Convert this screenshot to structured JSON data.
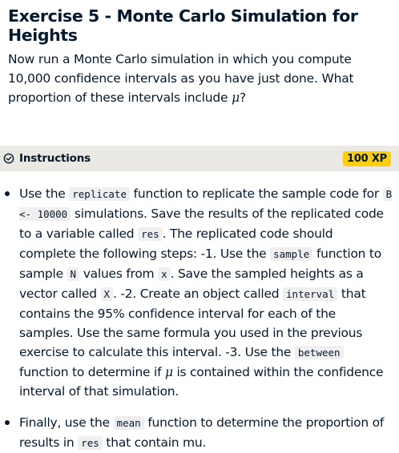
{
  "exercise": {
    "title": "Exercise 5 - Monte Carlo Simulation for Heights",
    "intro_text": "Now run a Monte Carlo simulation in which you compute 10,000 confidence intervals as you have just done. What proportion of these intervals include ",
    "intro_symbol": "μ",
    "intro_end": "?"
  },
  "instructions": {
    "label": "Instructions",
    "xp": "100 XP",
    "icon": "check-circle-icon"
  },
  "steps": [
    {
      "s1": "Use the ",
      "c1": "replicate",
      "s2": " function to replicate the sample code for ",
      "c2": "B <- 10000",
      "s3": " simulations. Save the results of the replicated code to a variable called ",
      "c3": "res",
      "s4": ". The replicated code should complete the following steps: -1. Use the ",
      "c4": "sample",
      "s5": " function to sample ",
      "c5": "N",
      "s6": " values from ",
      "c6": "x",
      "s7": ". Save the sampled heights as a vector called ",
      "c7": "X",
      "s8": ". -2. Create an object called ",
      "c8": "interval",
      "s9": " that contains the 95% confidence interval for each of the samples. Use the same formula you used in the previous exercise to calculate this interval. -3. Use the ",
      "c9": "between",
      "s10": " function to determine if ",
      "mu": "μ",
      "s11": " is contained within the confidence interval of that simulation."
    },
    {
      "s1": "Finally, use the ",
      "c1": "mean",
      "s2": " function to determine the proportion of results in ",
      "c2": "res",
      "s3": " that contain mu."
    }
  ]
}
